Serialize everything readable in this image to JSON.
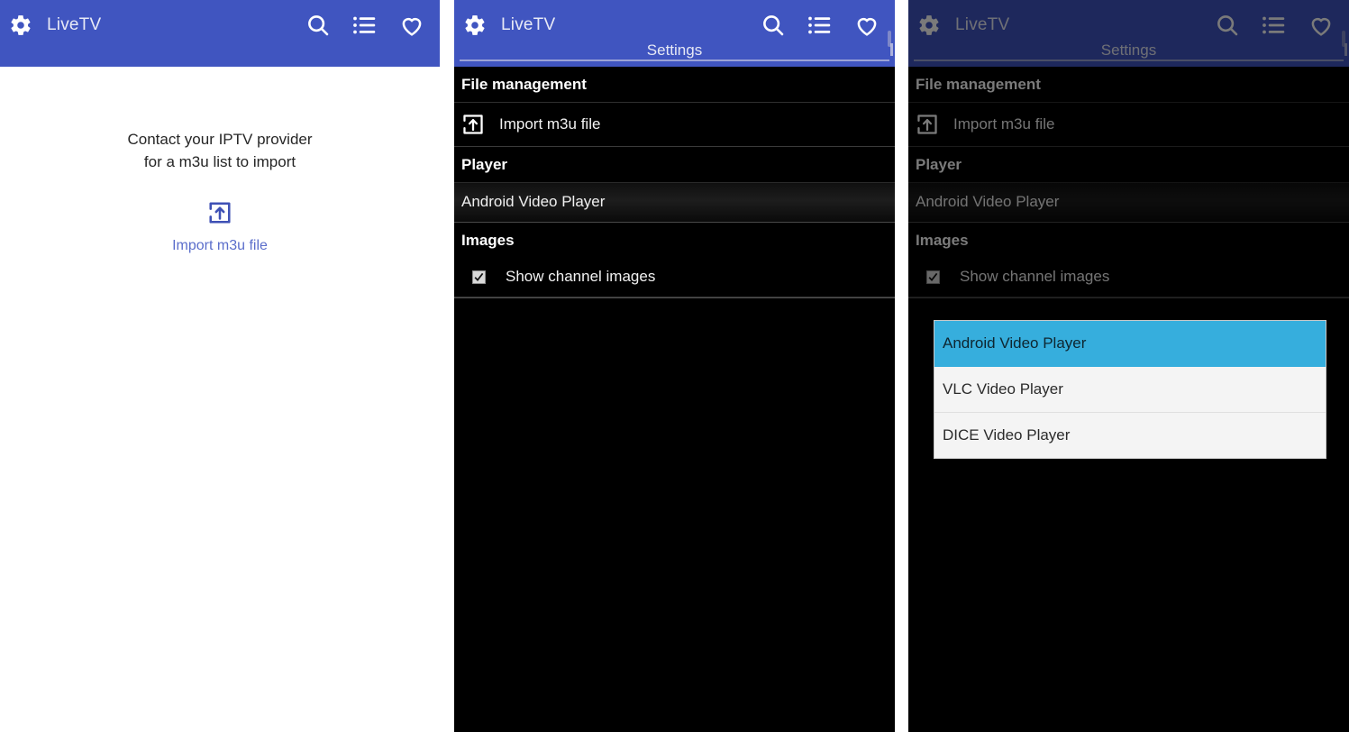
{
  "app": {
    "title": "LiveTV",
    "brand_color": "#4055c0",
    "icons": {
      "gear": "gear-icon",
      "search": "search-icon",
      "list": "list-icon",
      "favorite": "heart-icon",
      "import": "import-file-icon"
    }
  },
  "panel1": {
    "hint_line1": "Contact your IPTV provider",
    "hint_line2": "for a m3u list to import",
    "import_label": "Import m3u file",
    "link_color": "#5b6ecb"
  },
  "panel2": {
    "subtitle": "Settings",
    "sections": [
      {
        "header": "File management",
        "rows": [
          {
            "type": "action",
            "label": "Import m3u file",
            "icon": "import-file-icon"
          }
        ]
      },
      {
        "header": "Player",
        "rows": [
          {
            "type": "value",
            "label": "Android Video Player"
          }
        ]
      },
      {
        "header": "Images",
        "rows": [
          {
            "type": "checkbox",
            "label": "Show channel images",
            "checked": true
          }
        ]
      }
    ]
  },
  "panel3": {
    "subtitle": "Settings",
    "dimmed": true,
    "sections": [
      {
        "header": "File management",
        "rows": [
          {
            "type": "action",
            "label": "Import m3u file",
            "icon": "import-file-icon"
          }
        ]
      },
      {
        "header": "Player",
        "rows": [
          {
            "type": "value",
            "label": "Android Video Player"
          }
        ]
      },
      {
        "header": "Images",
        "rows": [
          {
            "type": "checkbox",
            "label": "Show channel images",
            "checked": true
          }
        ]
      }
    ],
    "dropdown": {
      "selected_index": 0,
      "highlight_color": "#36aedd",
      "options": [
        "Android Video Player",
        "VLC Video Player",
        "DICE Video Player"
      ]
    }
  }
}
